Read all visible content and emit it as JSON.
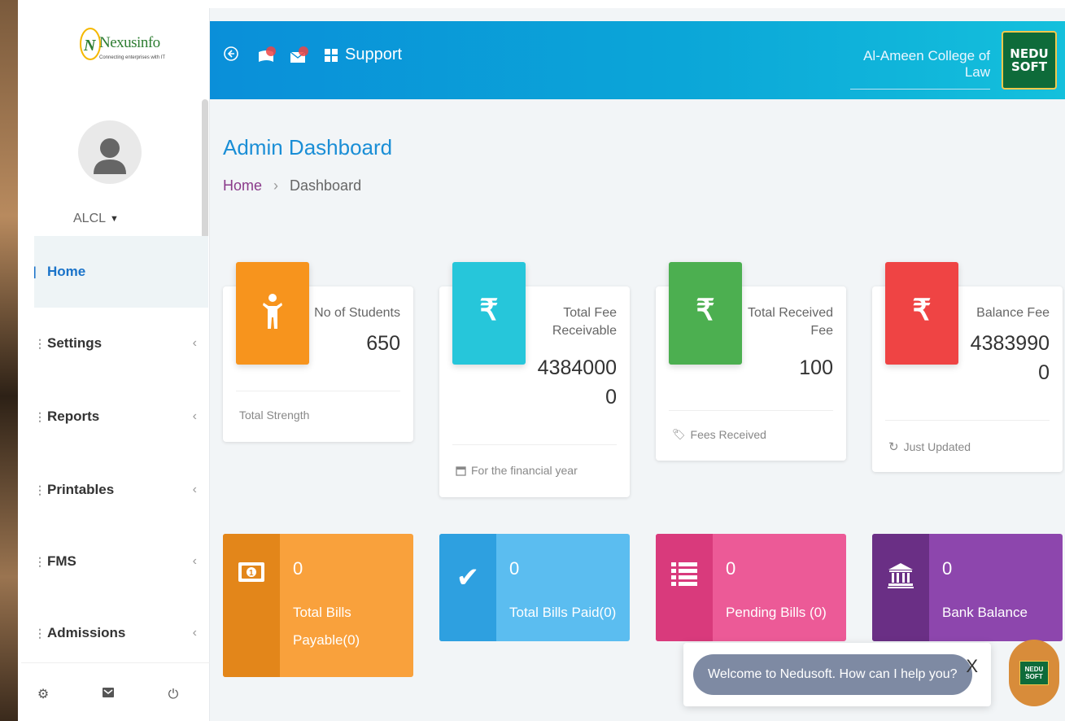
{
  "brand": {
    "name": "Nexusinfo",
    "tagline": "Connecting enterprises with IT"
  },
  "user": {
    "name": "ALCL"
  },
  "sidebar": {
    "items": [
      {
        "label": "Home",
        "active": true
      },
      {
        "label": "Settings",
        "chevron": "‹"
      },
      {
        "label": "Reports",
        "chevron": "‹"
      },
      {
        "label": "Printables",
        "chevron": "‹"
      },
      {
        "label": "FMS",
        "chevron": "‹"
      },
      {
        "label": "Admissions",
        "chevron": "‹"
      }
    ],
    "footer_icons": [
      "gear-icon",
      "mail-icon",
      "power-icon"
    ]
  },
  "header": {
    "support_label": "Support",
    "college_name": "Al-Ameen College of Law",
    "logo_line1": "NEDU",
    "logo_line2": "SOFT",
    "gradient_start": "#0a8fd9",
    "gradient_end": "#14c0dc"
  },
  "page": {
    "title": "Admin Dashboard",
    "breadcrumb": {
      "home": "Home",
      "separator": "›",
      "current": "Dashboard"
    }
  },
  "stats": [
    {
      "label_lines": [
        "No of Students"
      ],
      "value_lines": [
        "650"
      ],
      "footer": "Total Strength",
      "footer_icon": "",
      "color": "#f7941d"
    },
    {
      "label_lines": [
        "Total Fee",
        "Receivable"
      ],
      "value_lines": [
        "4384000",
        "0"
      ],
      "footer": "For the financial year",
      "footer_icon": "calendar-icon",
      "color": "#26c6da"
    },
    {
      "label_lines": [
        "Total Received",
        "Fee"
      ],
      "value_lines": [
        "100"
      ],
      "footer": "Fees Received",
      "footer_icon": "tag-icon",
      "color": "#4caf50"
    },
    {
      "label_lines": [
        "Balance Fee"
      ],
      "value_lines": [
        "4383990",
        "0"
      ],
      "footer": "Just Updated",
      "footer_icon": "refresh-icon",
      "color": "#ef4444"
    }
  ],
  "tiles": [
    {
      "count": "0",
      "label": "Total Bills Payable(0)",
      "icon": "money-icon",
      "color": "#f9a13c",
      "dark": "#e3861a"
    },
    {
      "count": "0",
      "label": "Total Bills Paid(0)",
      "icon": "check-icon",
      "color": "#5bbdf0",
      "dark": "#2ea0e0"
    },
    {
      "count": "0",
      "label": "Pending Bills (0)",
      "icon": "list-icon",
      "color": "#ec5a97",
      "dark": "#d93a7c"
    },
    {
      "count": "0",
      "label": "Bank Balance",
      "icon": "bank-icon",
      "color": "#8d46ad",
      "dark": "#6a2f85"
    }
  ],
  "chat": {
    "message": "Welcome to Nedusoft. How can I help you?",
    "close_label": "X"
  }
}
